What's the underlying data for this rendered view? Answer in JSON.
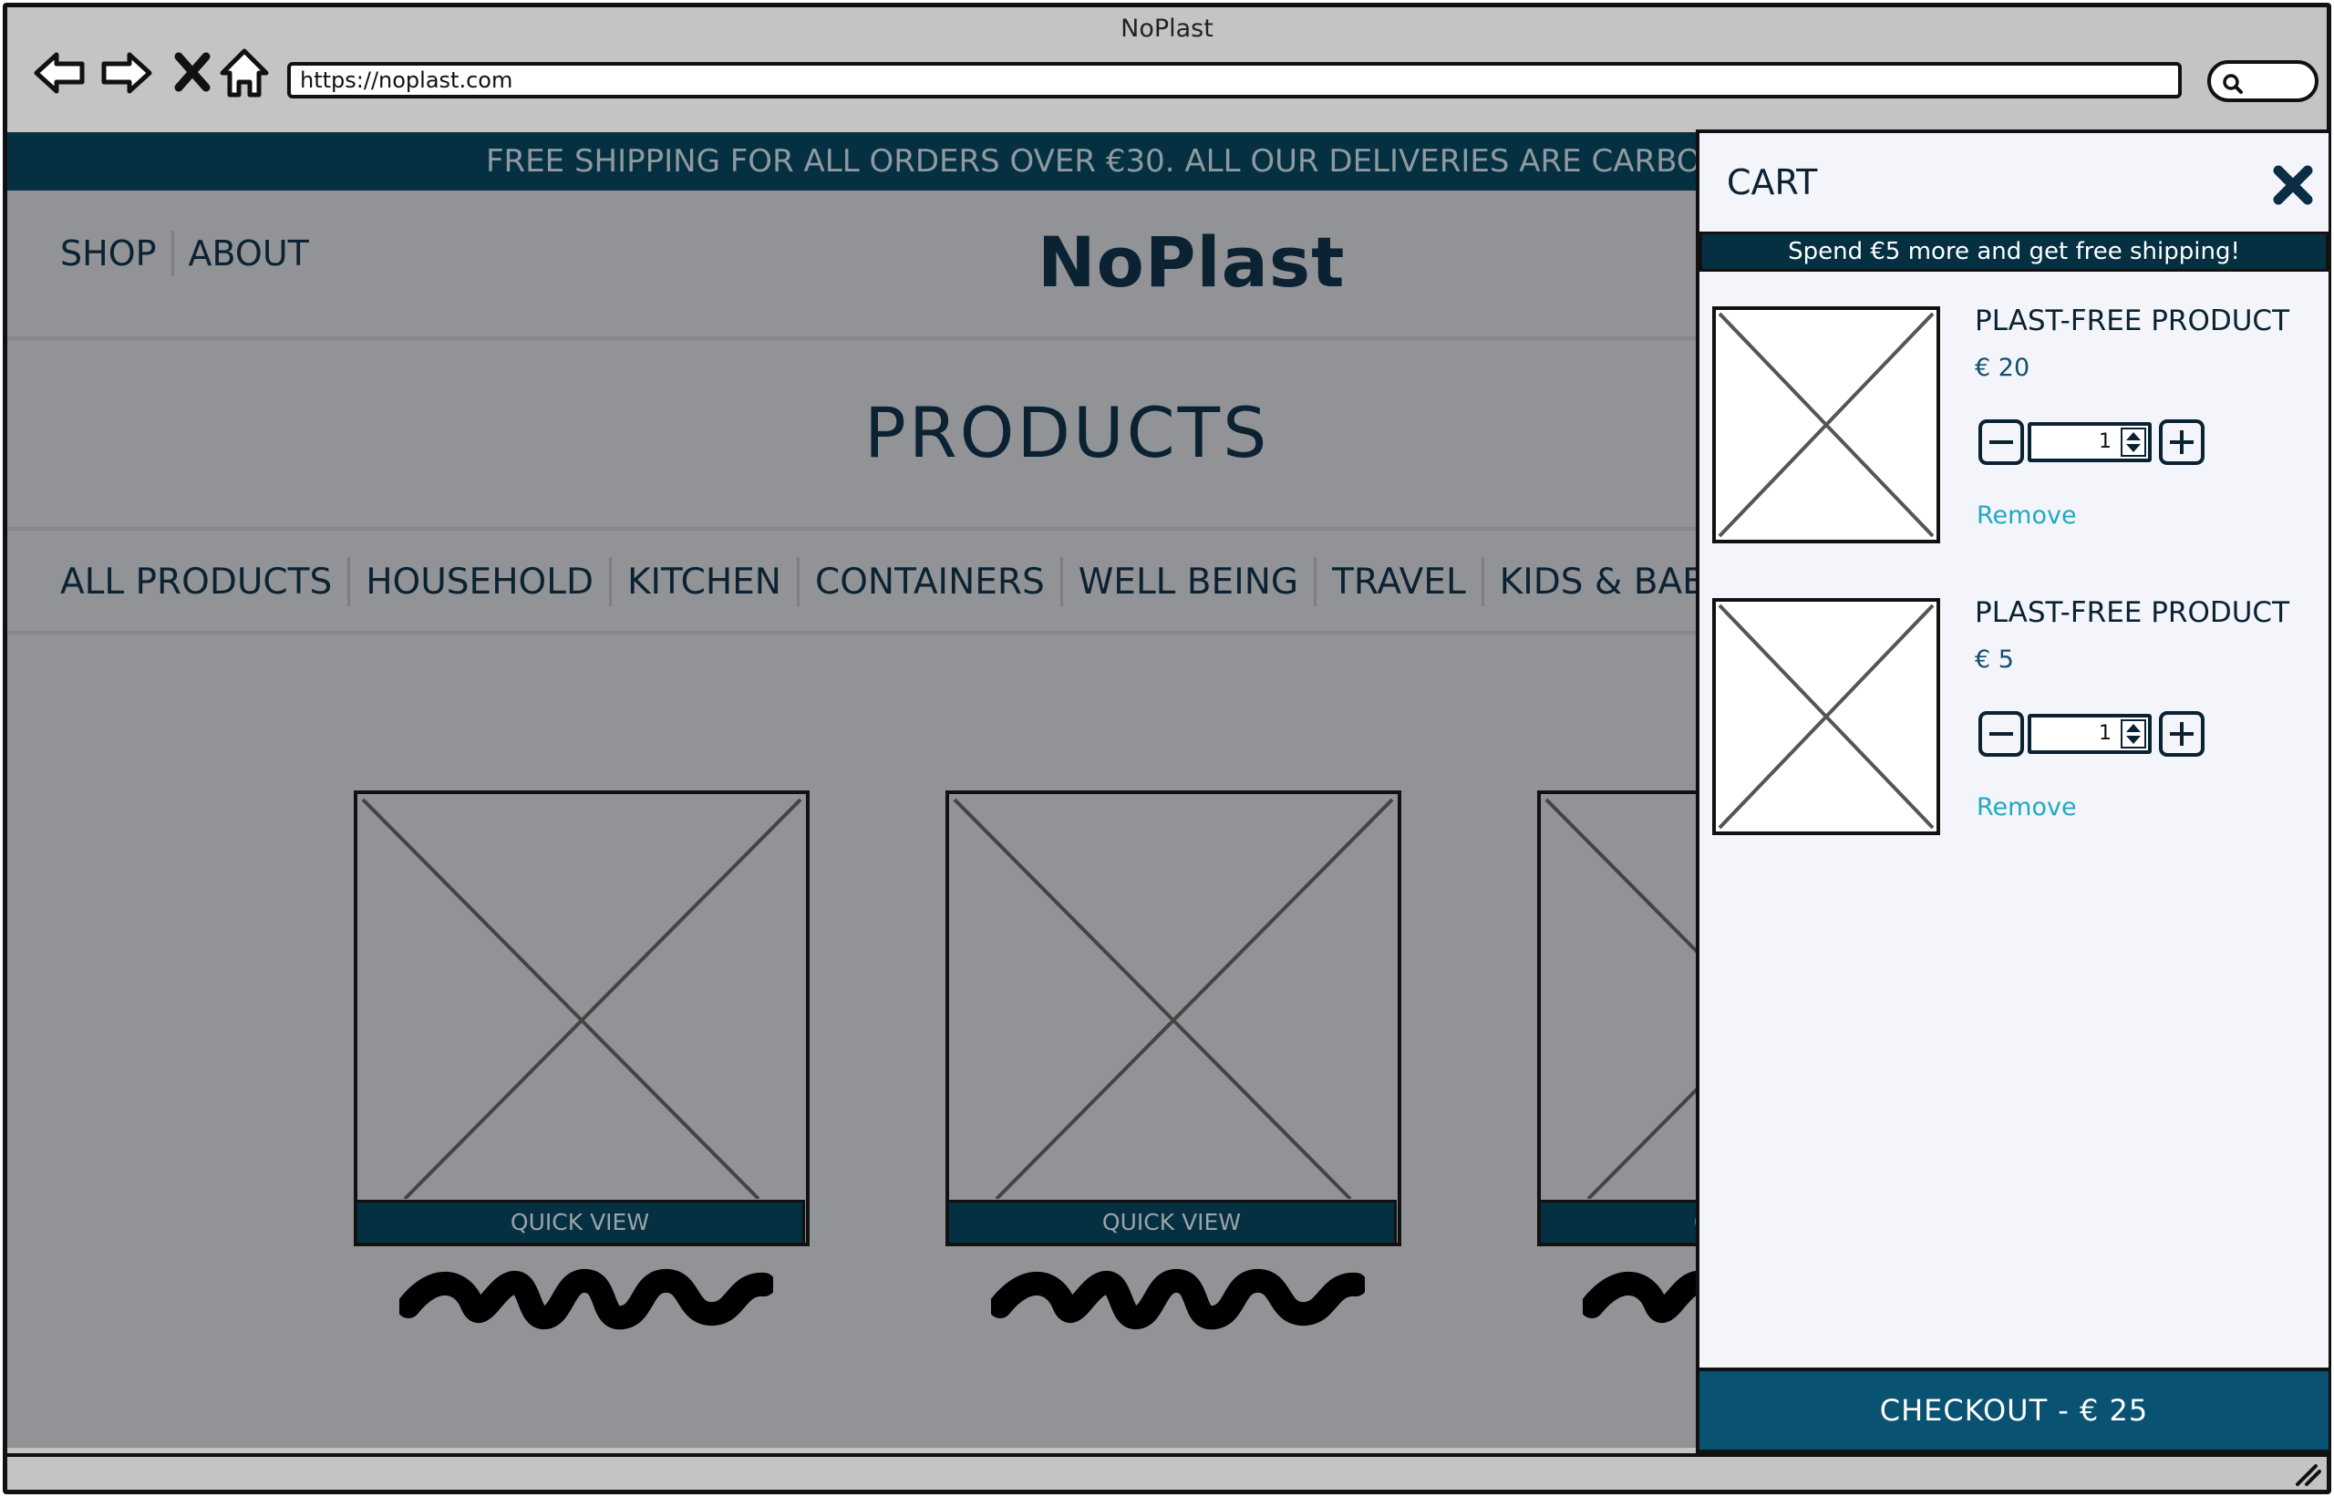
{
  "window": {
    "title": "NoPlast"
  },
  "browser": {
    "url": "https://noplast.com",
    "icons": [
      "back-arrow-icon",
      "forward-arrow-icon",
      "close-icon",
      "home-icon",
      "search-icon"
    ]
  },
  "promo": {
    "text": "FREE SHIPPING FOR ALL ORDERS OVER €30. ALL OUR DELIVERIES ARE CARBON"
  },
  "header": {
    "nav": [
      "SHOP",
      "ABOUT"
    ],
    "logo": "NoPlast"
  },
  "page_title": "PRODUCTS",
  "categories": [
    "ALL PRODUCTS",
    "HOUSEHOLD",
    "KITCHEN",
    "CONTAINERS",
    "WELL BEING",
    "TRAVEL",
    "KIDS & BABY"
  ],
  "products": [
    {
      "quick_view": "QUICK VIEW"
    },
    {
      "quick_view": "QUICK VIEW"
    },
    {
      "quick_view": "QUICK VIEW"
    }
  ],
  "cart": {
    "title": "CART",
    "shipping_message": "Spend €5 more and get free shipping!",
    "items": [
      {
        "name": "PLAST-FREE PRODUCT",
        "price": "€ 20",
        "quantity": "1",
        "remove_label": "Remove"
      },
      {
        "name": "PLAST-FREE PRODUCT",
        "price": "€ 5",
        "quantity": "1",
        "remove_label": "Remove"
      }
    ],
    "checkout_label": "CHECKOUT - € 25"
  },
  "colors": {
    "dark_navy": "#053042",
    "checkout_blue": "#0a5272",
    "link_cyan": "#22a8c4",
    "overlay_gray": "#929396"
  }
}
